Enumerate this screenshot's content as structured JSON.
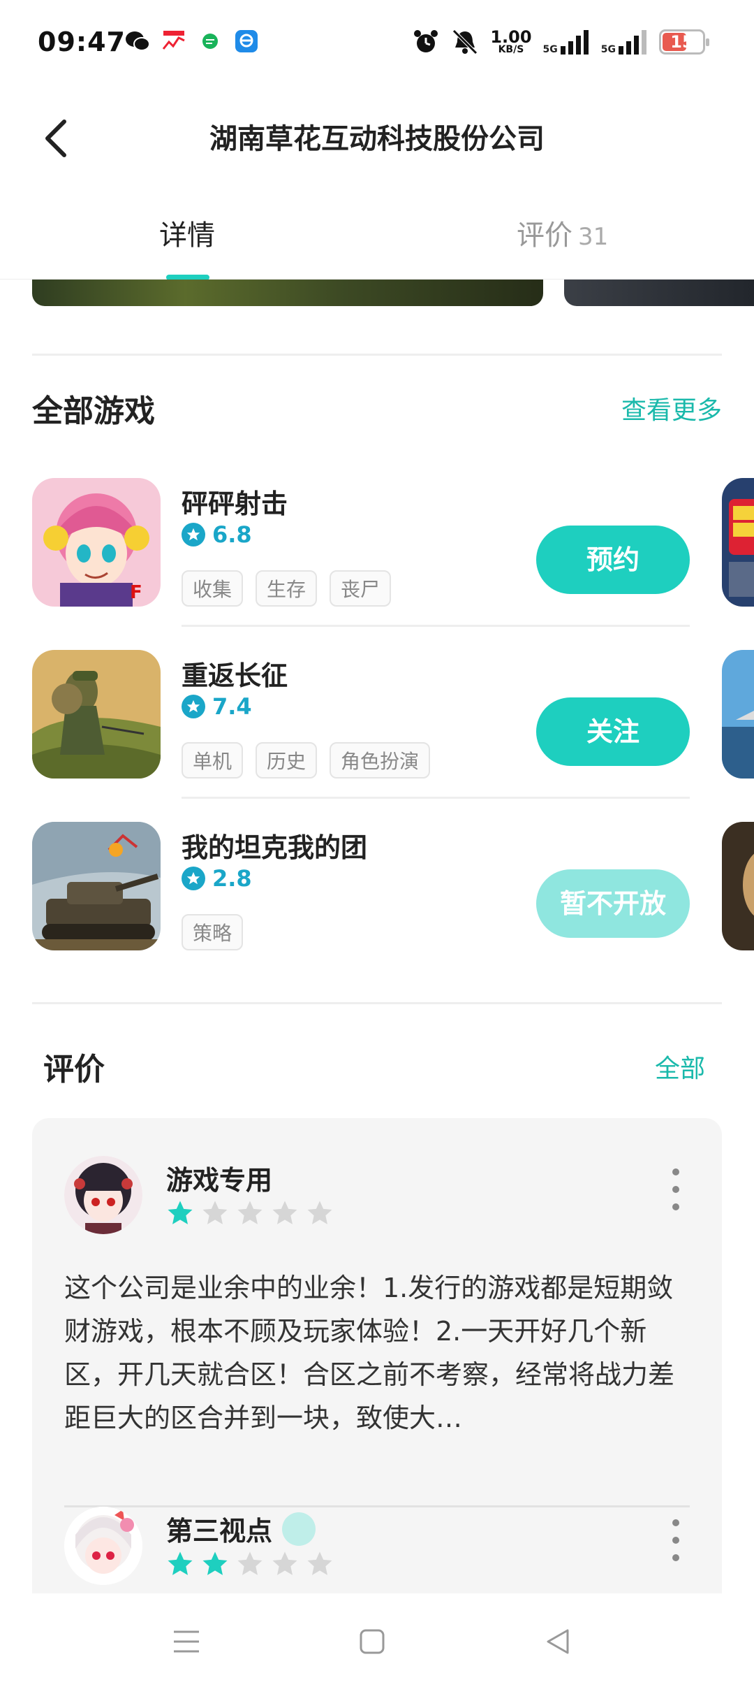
{
  "status_bar": {
    "time": "09:47",
    "net_speed_value": "1.00",
    "net_speed_unit": "KB/S",
    "signal1": "5G",
    "signal2": "5G",
    "battery": "15",
    "battery_level": 0.15,
    "app_icons": [
      "wechat-icon",
      "stock-app-icon",
      "chat-bubble-icon",
      "browser-app-icon"
    ]
  },
  "header": {
    "title": "湖南草花互动科技股份公司"
  },
  "tabs": [
    {
      "label": "详情",
      "active": true
    },
    {
      "label": "评价",
      "count": "31",
      "active": false
    }
  ],
  "games_section": {
    "title": "全部游戏",
    "more_label": "查看更多",
    "games": [
      {
        "name": "砰砰射击",
        "rating": "6.8",
        "tags": [
          "收集",
          "生存",
          "丧尸"
        ],
        "button": "预约"
      },
      {
        "name": "重返长征",
        "rating": "7.4",
        "tags": [
          "单机",
          "历史",
          "角色扮演"
        ],
        "button": "关注"
      },
      {
        "name": "我的坦克我的团",
        "rating": "2.8",
        "tags": [
          "策略"
        ],
        "button": "暂不开放"
      }
    ]
  },
  "reviews_section": {
    "title": "评价",
    "all_label": "全部",
    "reviews": [
      {
        "user": "游戏专用",
        "stars": 1,
        "text": "这个公司是业余中的业余！1.发行的游戏都是短期敛财游戏，根本不顾及玩家体验！2.一天开好几个新区，开几天就合区！合区之前不考察，经常将战力差距巨大的区合并到一块，致使大…"
      },
      {
        "user": "第三视点",
        "stars": 2,
        "text": ""
      }
    ]
  },
  "colors": {
    "accent": "#1ecfbf",
    "accent_disabled": "#8fe6df",
    "rating": "#1aa6c8",
    "link": "#1ab9ab"
  }
}
